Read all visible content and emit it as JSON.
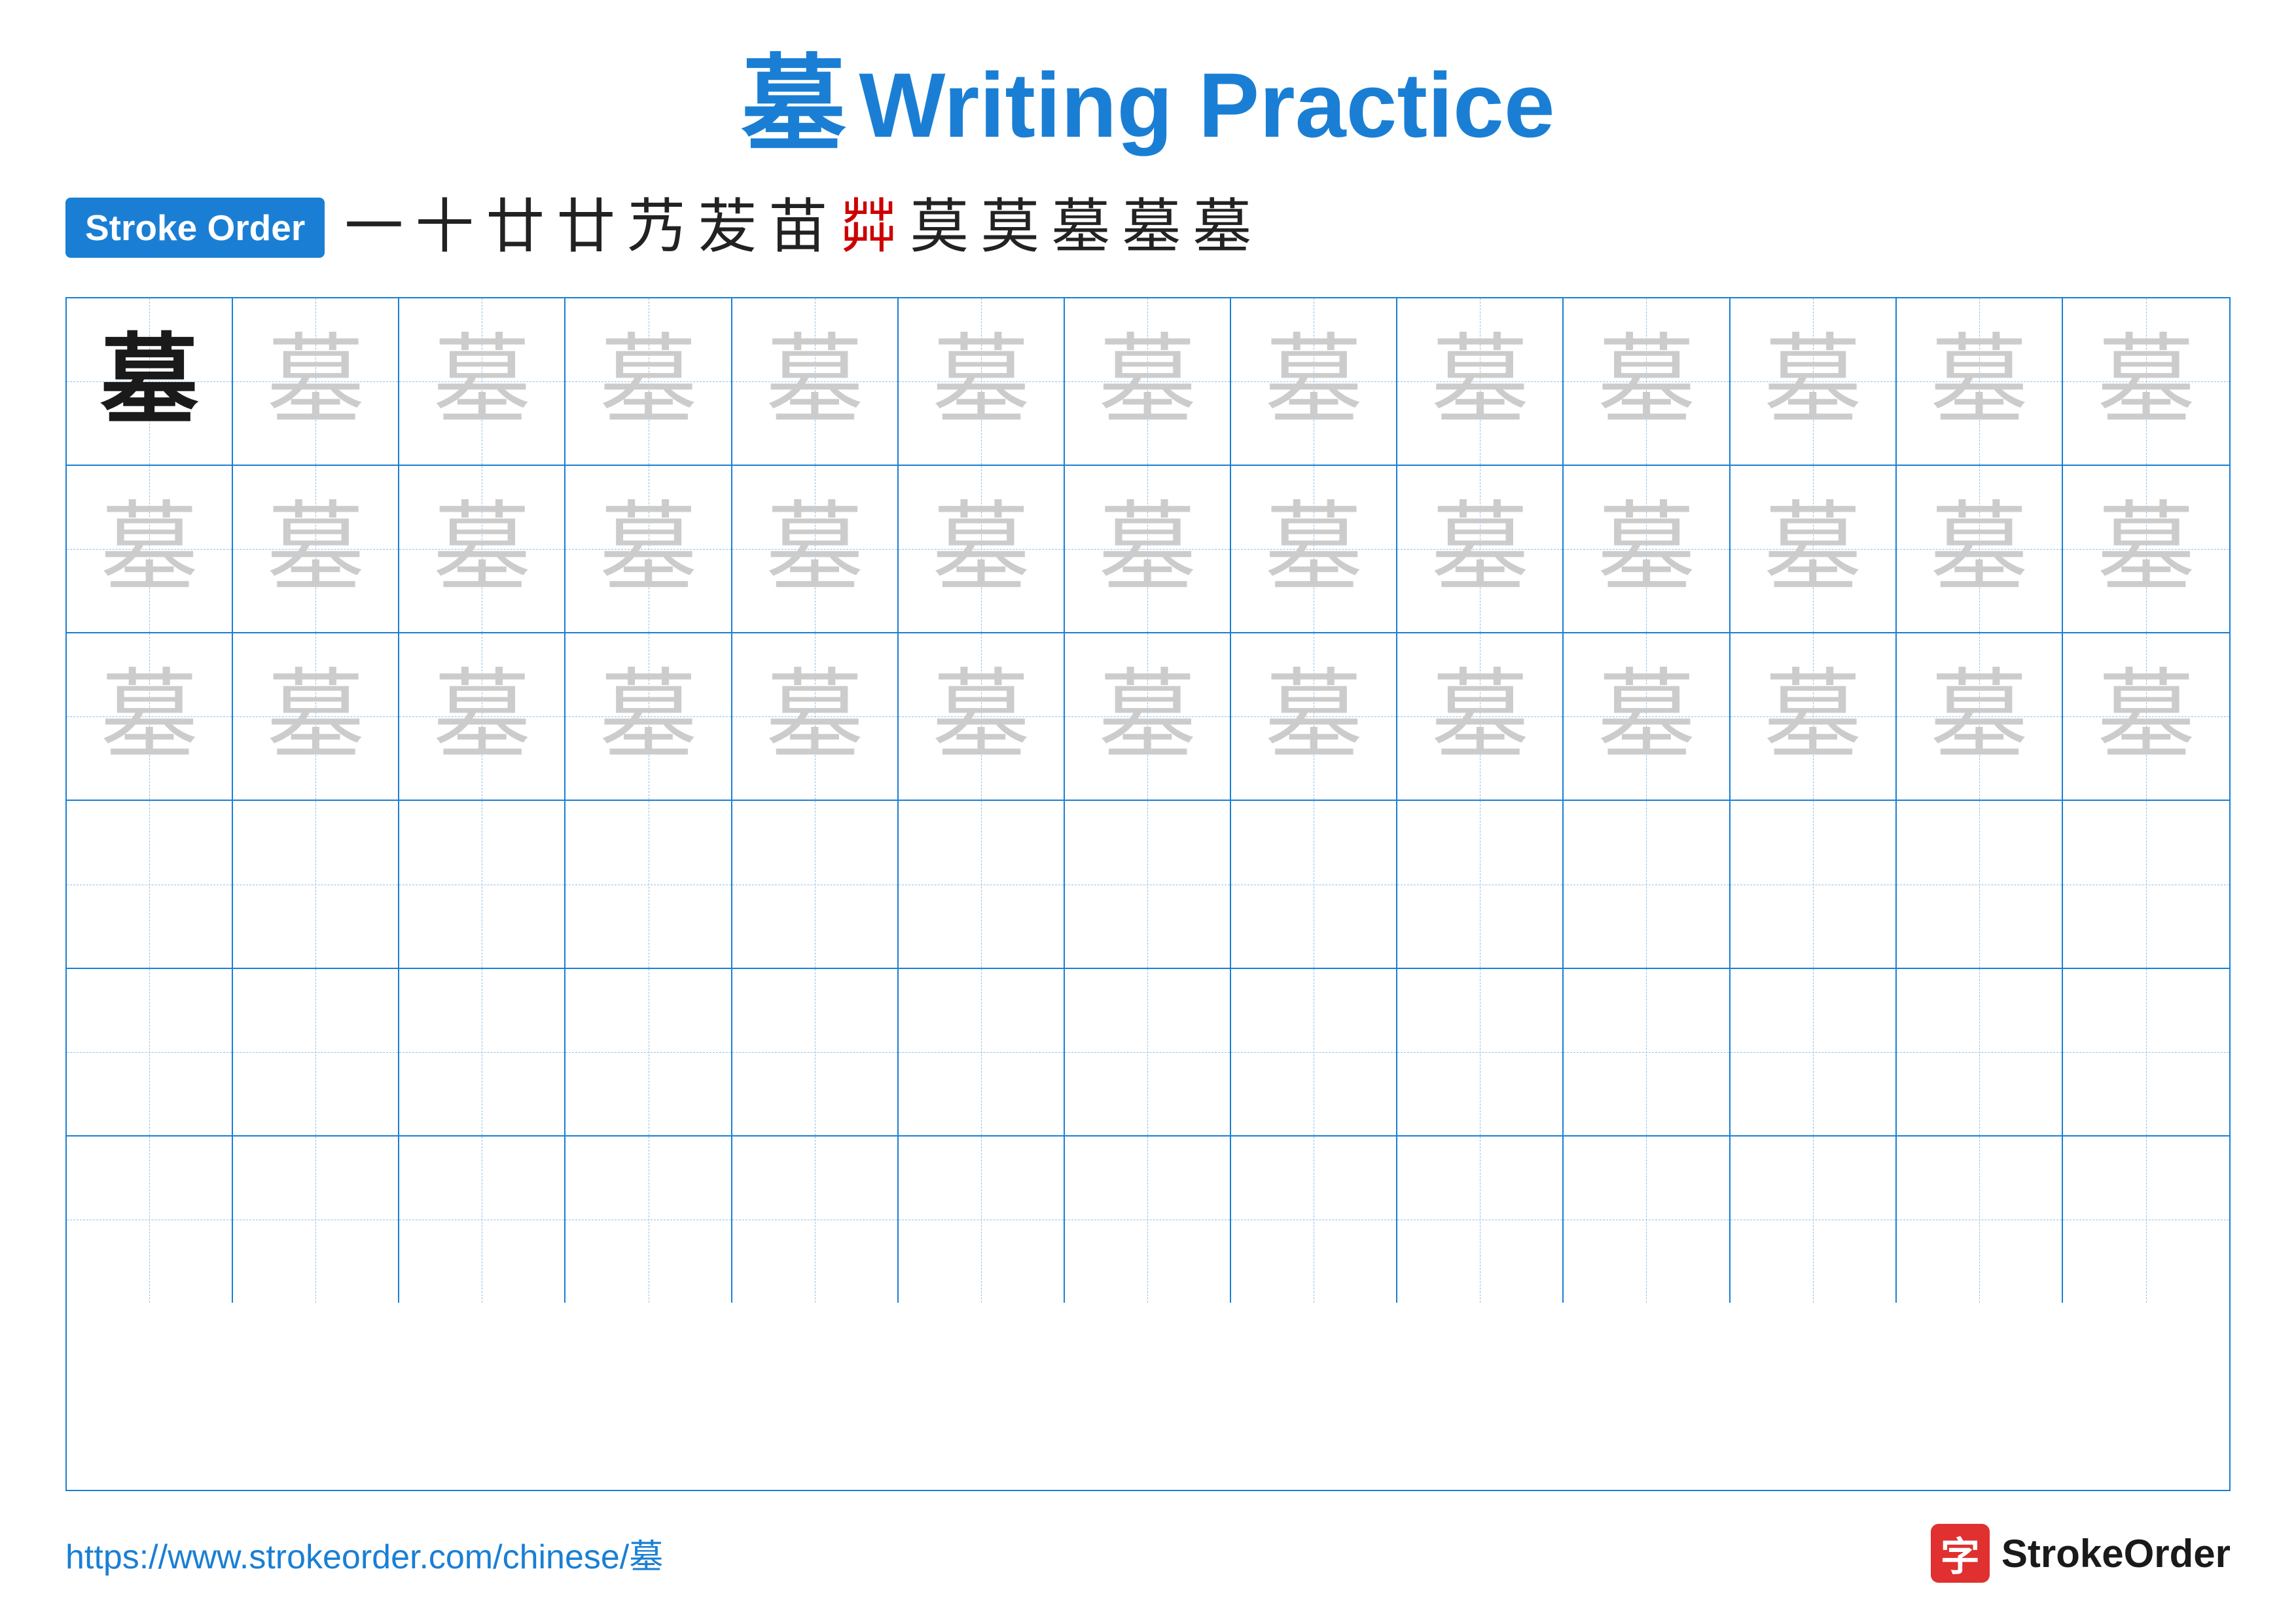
{
  "title": {
    "chinese": "墓",
    "english": "Writing Practice"
  },
  "strokeOrder": {
    "badge": "Stroke Order",
    "strokes": [
      "一",
      "十",
      "廿",
      "廿",
      "艿",
      "苃",
      "苗",
      "茻",
      "莫",
      "莫",
      "墓",
      "墓",
      "墓"
    ],
    "highlightIndex": 7
  },
  "grid": {
    "rows": 6,
    "cols": 13,
    "character": "墓",
    "row1": [
      "dark",
      "light",
      "light",
      "light",
      "light",
      "light",
      "light",
      "light",
      "light",
      "light",
      "light",
      "light",
      "light"
    ],
    "row2": [
      "light",
      "light",
      "light",
      "light",
      "light",
      "light",
      "light",
      "light",
      "light",
      "light",
      "light",
      "light",
      "light"
    ],
    "row3": [
      "light",
      "light",
      "light",
      "light",
      "light",
      "light",
      "light",
      "light",
      "light",
      "light",
      "light",
      "light",
      "light"
    ],
    "row4": [
      "empty",
      "empty",
      "empty",
      "empty",
      "empty",
      "empty",
      "empty",
      "empty",
      "empty",
      "empty",
      "empty",
      "empty",
      "empty"
    ],
    "row5": [
      "empty",
      "empty",
      "empty",
      "empty",
      "empty",
      "empty",
      "empty",
      "empty",
      "empty",
      "empty",
      "empty",
      "empty",
      "empty"
    ],
    "row6": [
      "empty",
      "empty",
      "empty",
      "empty",
      "empty",
      "empty",
      "empty",
      "empty",
      "empty",
      "empty",
      "empty",
      "empty",
      "empty"
    ]
  },
  "footer": {
    "url": "https://www.strokeorder.com/chinese/墓",
    "logoChar": "字",
    "logoText": "StrokeOrder"
  }
}
